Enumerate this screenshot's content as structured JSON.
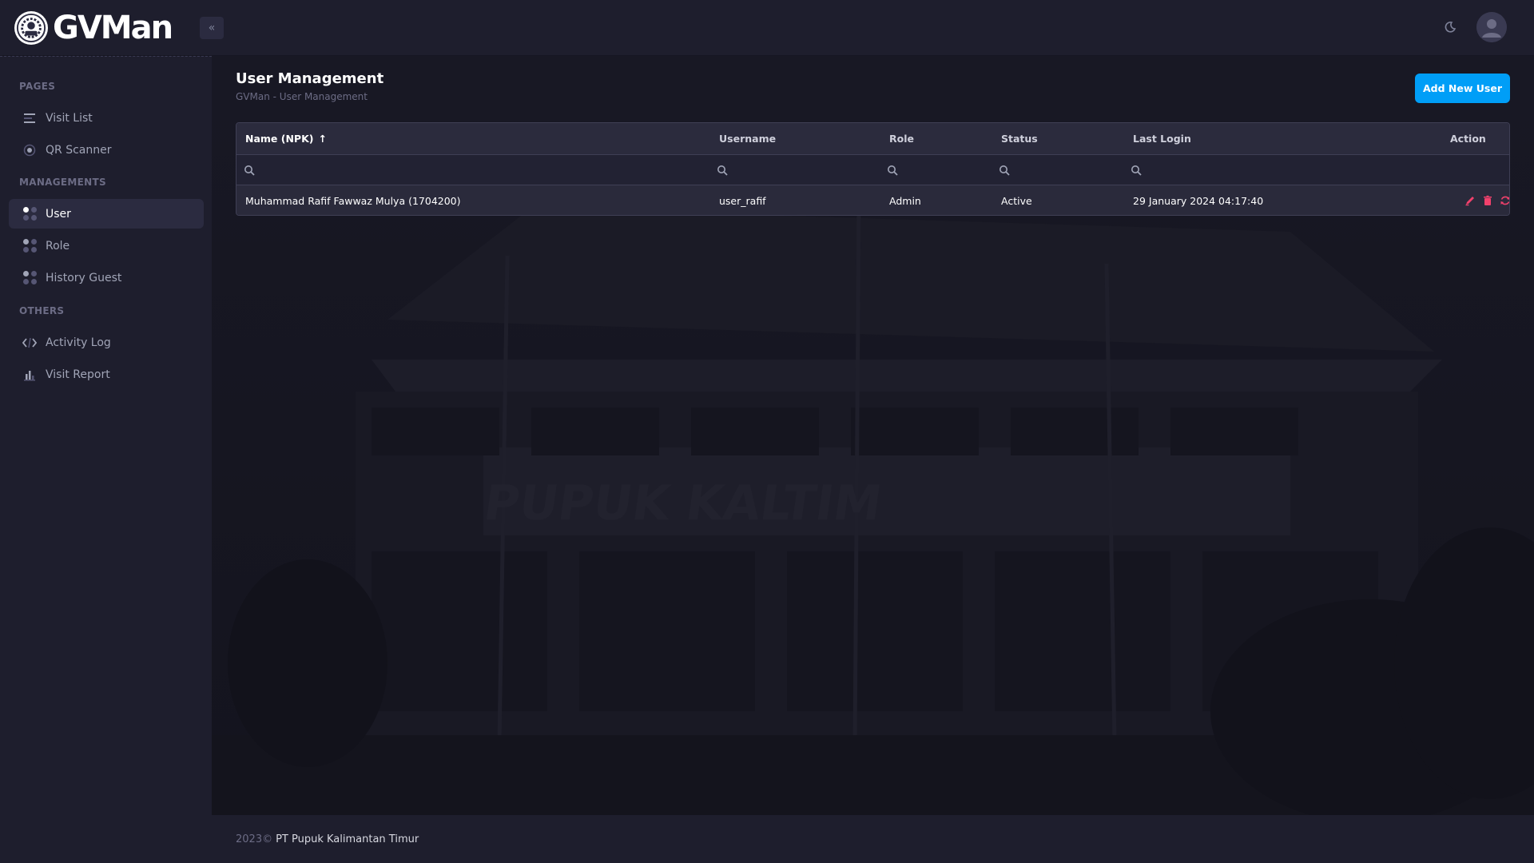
{
  "app": {
    "name": "GVMan"
  },
  "header": {
    "collapse_icon": "double-chevron-left-icon",
    "theme_icon": "moon-icon",
    "avatar_icon": "user-avatar-icon"
  },
  "sidebar": {
    "sections": [
      {
        "title": "PAGES"
      },
      {
        "title": "MANAGEMENTS"
      },
      {
        "title": "OTHERS"
      }
    ],
    "items": [
      {
        "label": "Visit List",
        "icon": "list-icon"
      },
      {
        "label": "QR Scanner",
        "icon": "target-icon"
      },
      {
        "label": "User",
        "icon": "dots-grid-icon",
        "active": true
      },
      {
        "label": "Role",
        "icon": "dots-grid-icon"
      },
      {
        "label": "History Guest",
        "icon": "dots-grid-icon"
      },
      {
        "label": "Activity Log",
        "icon": "code-icon"
      },
      {
        "label": "Visit Report",
        "icon": "bar-chart-icon"
      }
    ]
  },
  "main": {
    "title": "User Management",
    "breadcrumb": "GVMan - User Management",
    "add_button": "Add New User",
    "table": {
      "columns": [
        "Name (NPK)",
        "Username",
        "Role",
        "Status",
        "Last Login",
        "Action"
      ],
      "sort_indicator": "↑",
      "rows": [
        {
          "name": "Muhammad Rafif Fawwaz Mulya (1704200)",
          "username": "user_rafif",
          "role": "Admin",
          "status": "Active",
          "last_login": "29 January 2024 04:17:40"
        }
      ],
      "action_icons": [
        "edit-icon",
        "delete-icon",
        "reset-icon"
      ]
    },
    "background_sign": "PUPUK KALTIM"
  },
  "footer": {
    "year": "2023©",
    "company": "PT Pupuk Kalimantan Timur"
  },
  "colors": {
    "accent": "#009ef7",
    "danger": "#f1416c",
    "background": "#1e1e2d",
    "content_background": "#151521"
  }
}
